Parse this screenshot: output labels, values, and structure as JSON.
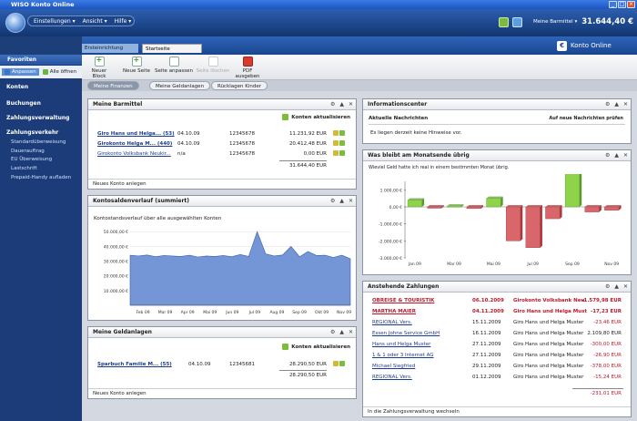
{
  "window": {
    "title": "WISO Konto Online"
  },
  "menu": [
    "Einstellungen ▾",
    "Ansicht ▾",
    "Hilfe ▾"
  ],
  "account": {
    "name": "Meine Barmittel ▾",
    "balance": "31.644,40 €"
  },
  "tabs": [
    "Ersteinrichtung",
    "Startseite"
  ],
  "brand": "Konto Online",
  "sidebar": {
    "favorites": "Favoriten",
    "btn_open": "Anpassen",
    "btn_all": "Alle öffnen",
    "sections": [
      "Konten",
      "Buchungen",
      "Zahlungsverwaltung",
      "Zahlungsverkehr"
    ],
    "sub_items": [
      "Standardüberweisung",
      "Dauerauftrag",
      "EU Überweisung",
      "Lastschrift",
      "Prepaid-Handy aufladen"
    ]
  },
  "toolbar": {
    "buttons": [
      "Neuer Block",
      "Neue Seite",
      "Seite anpassen",
      "Seite löschen",
      "PDF ausgeben"
    ]
  },
  "subtabs": [
    "Meine Finanzen",
    "Meine Geldanlagen",
    "Rücklagen Kinder"
  ],
  "barmittel": {
    "title": "Meine Barmittel",
    "update": "Konten aktualisieren",
    "rows": [
      {
        "name": "Giro Hans und Helga... (53)",
        "date": "04.10.09",
        "nr": "12345678",
        "amount": "11.231,92 EUR"
      },
      {
        "name": "Girokonto Helga M... (440)",
        "date": "04.10.09",
        "nr": "12345678",
        "amount": "20.412,48 EUR"
      },
      {
        "name": "Girokonto Volksbank Neukir...",
        "date": "n/a",
        "nr": "12345678",
        "amount": "0,00 EUR"
      }
    ],
    "total": "31.644,40 EUR",
    "footer": "Neues Konto anlegen"
  },
  "verlauf": {
    "title": "Kontosaldenverlauf (summiert)",
    "subtitle": "Kontostandsverlauf über alle ausgewählten Konten"
  },
  "geldanlagen": {
    "title": "Meine Geldanlagen",
    "update": "Konten aktualisieren",
    "rows": [
      {
        "name": "Sparbuch Familie M... (55)",
        "date": "04.10.09",
        "nr": "12345681",
        "amount": "28.290,50 EUR"
      }
    ],
    "total": "28.290,50 EUR",
    "footer": "Neues Konto anlegen"
  },
  "info": {
    "title": "Informationscenter",
    "news": "Aktuelle Nachrichten",
    "check": "Auf neue Nachrichten prüfen",
    "message": "Es liegen derzeit keine Hinweise vor."
  },
  "remain": {
    "title": "Was bleibt am Monatsende übrig",
    "subtitle": "Wieviel Geld hatte ich real in einem bestimmten Monat übrig."
  },
  "payments": {
    "title": "Anstehende Zahlungen",
    "rows": [
      {
        "name": "OBREISE & TOURISTIK",
        "date": "06.10.2009",
        "account": "Girokonto Volksbank Neu",
        "amount": "-1.579,98 EUR",
        "overdue": true
      },
      {
        "name": "MARTHA MAIER",
        "date": "04.11.2009",
        "account": "Giro Hans und Helga Must",
        "amount": "-17,23 EUR",
        "overdue": true
      },
      {
        "name": "REGIONAL Vers.",
        "date": "15.11.2009",
        "account": "Giro Hans und Helga Muster",
        "amount": "-23,46 EUR",
        "overdue": false
      },
      {
        "name": "Essen Johne Service GmbH",
        "date": "16.11.2009",
        "account": "Giro Hans und Helga Muster",
        "amount": "2.109,80 EUR",
        "overdue": false
      },
      {
        "name": "Hans und Helga Muster",
        "date": "27.11.2009",
        "account": "Giro Hans und Helga Muster",
        "amount": "-300,00 EUR",
        "overdue": false
      },
      {
        "name": "1 & 1 oder 3 Internet AG",
        "date": "27.11.2009",
        "account": "Giro Hans und Helga Muster",
        "amount": "-26,90 EUR",
        "overdue": false
      },
      {
        "name": "Michael Siegfried",
        "date": "29.11.2009",
        "account": "Giro Hans und Helga Muster",
        "amount": "-378,00 EUR",
        "overdue": false
      },
      {
        "name": "REGIONAL Vers.",
        "date": "01.12.2009",
        "account": "Giro Hans und Helga Muster",
        "amount": "-15,24 EUR",
        "overdue": false
      }
    ],
    "total": "-231,01 EUR",
    "footer": "In die Zahlungsverwaltung wechseln"
  },
  "chart_data": [
    {
      "type": "area",
      "title": "Kontosaldenverlauf (summiert)",
      "xlabel": "",
      "ylabel": "",
      "x": [
        "Feb 09",
        "Mar 09",
        "Apr 09",
        "Mai 09",
        "Jun 09",
        "Jul 09",
        "Aug 09",
        "Sep 09",
        "Okt 09",
        "Nov 09"
      ],
      "yticks": [
        "10.000,00 €",
        "20.000,00 €",
        "30.000,00 €",
        "40.000,00 €",
        "50.000,00 €"
      ],
      "ylim": [
        0,
        52000
      ],
      "series": [
        {
          "values": [
            34000,
            33500,
            34200,
            33000,
            33800,
            33500,
            33200,
            34000,
            32800,
            33500,
            33200,
            33800,
            33000,
            34500,
            33200,
            50000,
            35000,
            33500,
            34200,
            40000,
            33000,
            36500,
            33800,
            34000,
            32500,
            34000,
            31600
          ]
        }
      ]
    },
    {
      "type": "bar",
      "title": "Was bleibt am Monatsende übrig",
      "xlabel": "",
      "ylabel": "",
      "categories": [
        "Jan 09",
        "Feb 09",
        "Mar 09",
        "Apr 09",
        "Mai 09",
        "Jun 09",
        "Jul 09",
        "Aug 09",
        "Sep 09",
        "Okt 09",
        "Nov 09"
      ],
      "values": [
        400,
        -80,
        50,
        -100,
        500,
        -2000,
        -2400,
        -700,
        2200,
        -300,
        -200
      ],
      "yticks": [
        "-3.000,00 €",
        "-2.000,00 €",
        "-1.000,00 €",
        "0,00 €",
        "1.000,00 €"
      ],
      "ylim": [
        -3000,
        1500
      ],
      "positive_color": "#8fd34a",
      "negative_color": "#d9666a"
    }
  ]
}
